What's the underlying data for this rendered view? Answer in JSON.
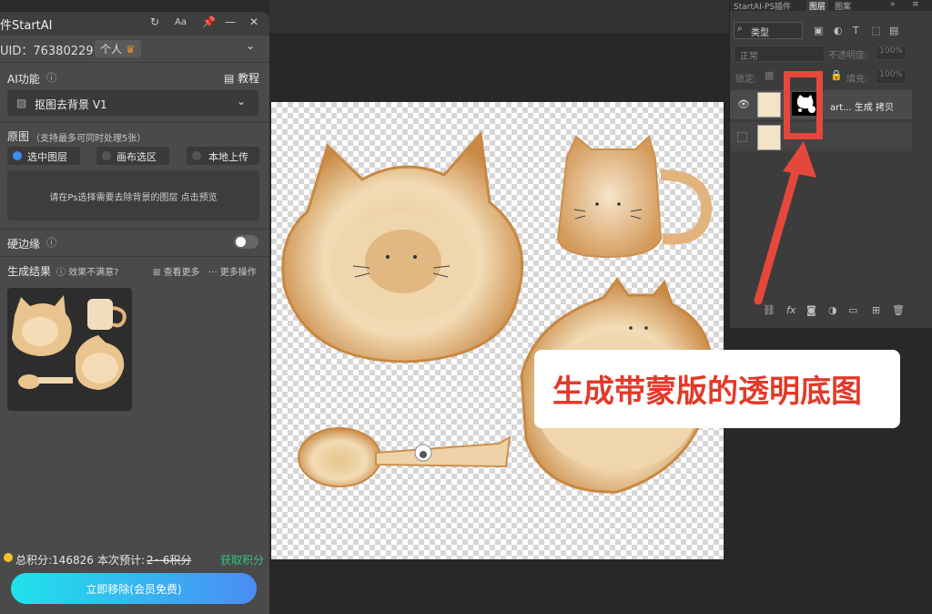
{
  "plugin": {
    "title": "件StartAI",
    "header_icons": {
      "refresh": "refresh-icon",
      "font": "Aa",
      "pin": "pin-icon",
      "minimize": "—",
      "close": "✕"
    },
    "uid_label": "UID：763802291",
    "account_type": "个人",
    "ai_section": "AI功能",
    "tutorial": "教程",
    "feature_select": "抠图去背景 V1",
    "original_label": "原图",
    "original_hint": "（支持最多可同时处理5张）",
    "sources": [
      "选中图层",
      "画布选区",
      "本地上传"
    ],
    "selected_source": 0,
    "preview_hint": "请在Ps选择需要去除背景的图层 点击预览",
    "hard_edge": "硬边缘",
    "hard_edge_on": false,
    "results_label": "生成结果",
    "feedback": "效果不满意?",
    "view_more": "查看更多",
    "more_actions": "更多操作",
    "points_total": "总积分:146826",
    "estimate_label": "本次预计:",
    "estimate_value": "2~6积分",
    "get_points": "获取积分",
    "action_button": "立即移除(会员免费)"
  },
  "layers_panel": {
    "tabs": [
      "StartAI-PS插件",
      "图层",
      "图案"
    ],
    "active_tab": 1,
    "filter": "类型",
    "blend_mode": "正常",
    "opacity_label": "不透明度:",
    "opacity_value": "100%",
    "lock_label": "锁定:",
    "fill_label": "填充:",
    "fill_value": "100%",
    "layers": [
      {
        "name": "art... 生成 拷贝",
        "visible": true,
        "has_mask": true
      },
      {
        "name": "",
        "visible": false,
        "has_mask": false
      }
    ]
  },
  "callout": {
    "text": "生成带蒙版的透明底图",
    "color": "#e23a2a"
  },
  "colors": {
    "accent_red": "#e5483a",
    "button_start": "#1fe3ea",
    "button_end": "#4b8cf5",
    "link_green": "#35c27a",
    "coin": "#f5c02a"
  }
}
